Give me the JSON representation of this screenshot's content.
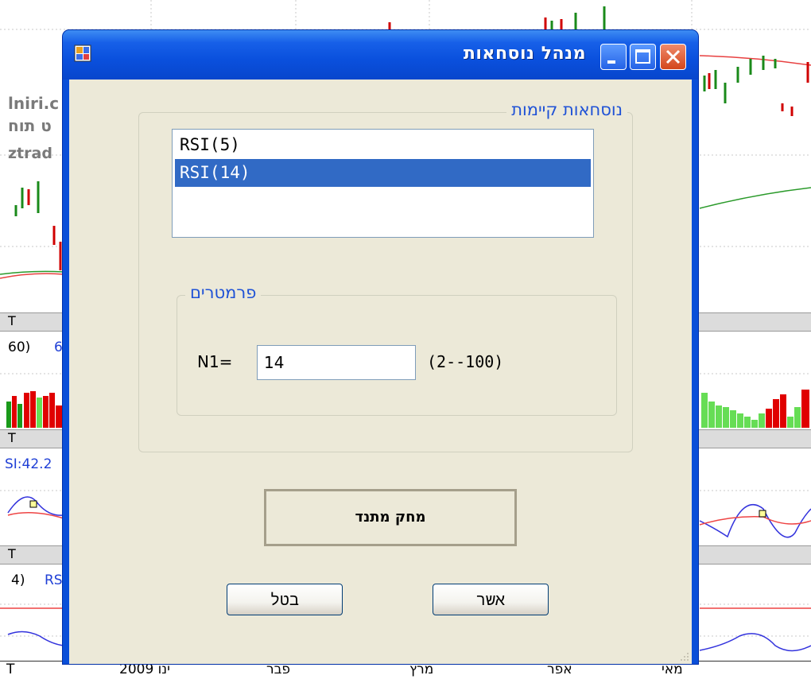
{
  "background_app": {
    "strip_texts": {
      "site_line1": "lniri.c",
      "site_line2": "ט תוח",
      "site_line3": "ztrad",
      "pane1_value": "60)",
      "pane1_value_blue": "6",
      "pane2_value": "SI:42.2",
      "pane3_value": "4)",
      "pane3_value_blue": "RS"
    },
    "pane_bar_marker": "T",
    "date_axis": [
      "2009 ינו",
      "פבר",
      "מרץ",
      "אפר",
      "מאי"
    ]
  },
  "window": {
    "title": "מנהל נוסחאות",
    "titlebar_buttons": [
      "minimize-icon",
      "maximize-icon",
      "close-icon"
    ]
  },
  "existing_formulas": {
    "group_title": "נוסחאות קיימות",
    "items": [
      {
        "label": "RSI(5)",
        "selected": false
      },
      {
        "label": "RSI(14)",
        "selected": true
      }
    ]
  },
  "parameters": {
    "group_title": "פרמטרים",
    "n1_label": "N1=",
    "n1_value": "14",
    "n1_range": "(2--100)"
  },
  "buttons": {
    "delete_indicator": "מחק מתנד",
    "cancel": "בטל",
    "ok": "אשר"
  },
  "colors": {
    "titlebar_blue": "#0a50dd",
    "selection_blue": "#316ac5",
    "group_title_blue": "#1f52d6",
    "dialog_face": "#ece9d8"
  }
}
